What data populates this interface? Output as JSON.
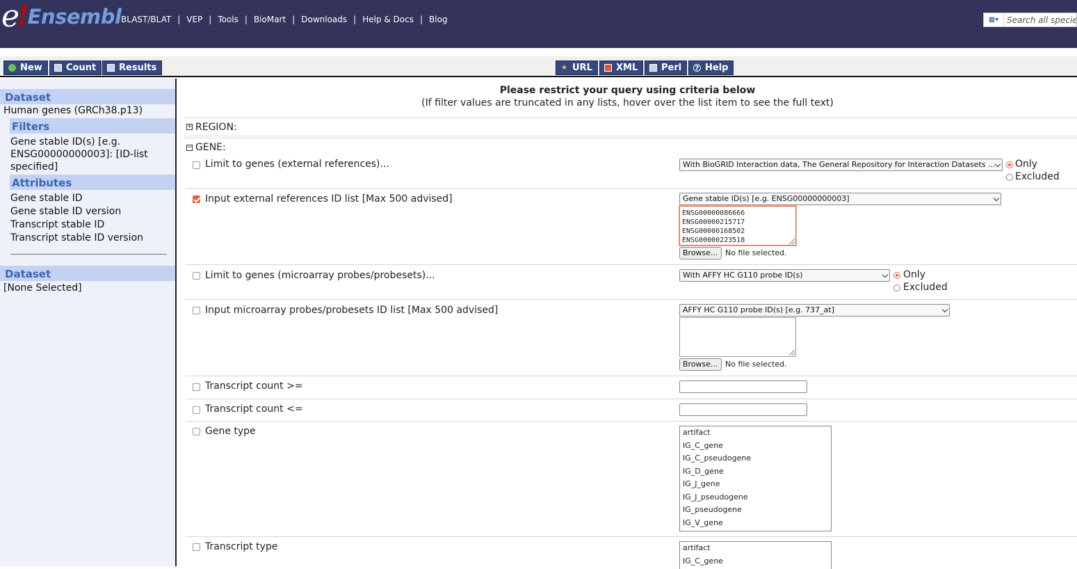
{
  "masthead": {
    "logo_e": "e",
    "logo_bang": "!",
    "logo_text": "Ensembl",
    "nav": [
      "BLAST/BLAT",
      "VEP",
      "Tools",
      "BioMart",
      "Downloads",
      "Help & Docs",
      "Blog"
    ],
    "search_placeholder": "Search all species..."
  },
  "toolbar": {
    "new": "New",
    "count": "Count",
    "results": "Results",
    "url": "URL",
    "xml": "XML",
    "perl": "Perl",
    "help": "Help"
  },
  "sidebar": {
    "dataset_heading": "Dataset",
    "dataset_name": "Human genes (GRCh38.p13)",
    "filters_heading": "Filters",
    "filter_summary": "Gene stable ID(s) [e.g. ENSG00000000003]: [ID-list specified]",
    "attributes_heading": "Attributes",
    "attributes": [
      "Gene stable ID",
      "Gene stable ID version",
      "Transcript stable ID",
      "Transcript stable ID version"
    ],
    "dataset2_heading": "Dataset",
    "dataset2_value": "[None Selected]"
  },
  "main": {
    "restrict_title": "Please restrict your query using criteria below",
    "restrict_note": "(If filter values are truncated in any lists, hover over the list item to see the full text)",
    "region_label": "REGION:",
    "gene_label": "GENE:",
    "filters": {
      "ext_refs_limit": {
        "label": "Limit to genes (external references)...",
        "select": "With BioGRID Interaction data, The General Repository for Interaction Datasets ...",
        "only": "Only",
        "excluded": "Excluded"
      },
      "ext_refs_input": {
        "label": "Input external references ID list [Max 500 advised]",
        "select": "Gene stable ID(s) [e.g. ENSG00000000003]",
        "ids": [
          "ENSG00000086666",
          "ENSG00000215717",
          "ENSG00000168502",
          "ENSG00000223518"
        ],
        "browse": "Browse...",
        "no_file": "No file selected."
      },
      "microarray_limit": {
        "label": "Limit to genes (microarray probes/probesets)...",
        "select": "With AFFY HC G110 probe ID(s)",
        "only": "Only",
        "excluded": "Excluded"
      },
      "microarray_input": {
        "label": "Input microarray probes/probesets ID list [Max 500 advised]",
        "select": "AFFY HC G110 probe ID(s) [e.g. 737_at]",
        "browse": "Browse...",
        "no_file": "No file selected."
      },
      "transcript_count_ge": {
        "label": "Transcript count >="
      },
      "transcript_count_le": {
        "label": "Transcript count <="
      },
      "gene_type": {
        "label": "Gene type",
        "options": [
          "artifact",
          "IG_C_gene",
          "IG_C_pseudogene",
          "IG_D_gene",
          "IG_J_gene",
          "IG_J_pseudogene",
          "IG_pseudogene",
          "IG_V_gene"
        ]
      },
      "transcript_type": {
        "label": "Transcript type",
        "options": [
          "artifact",
          "IG_C_gene"
        ]
      }
    }
  },
  "colors": {
    "masthead_bg": "#33335c",
    "button_bg": "#33487e",
    "sidebar_heading_bg": "#c3d1f2",
    "sidebar_heading_text": "#3b66b3",
    "accent_orange": "#e8643c"
  }
}
